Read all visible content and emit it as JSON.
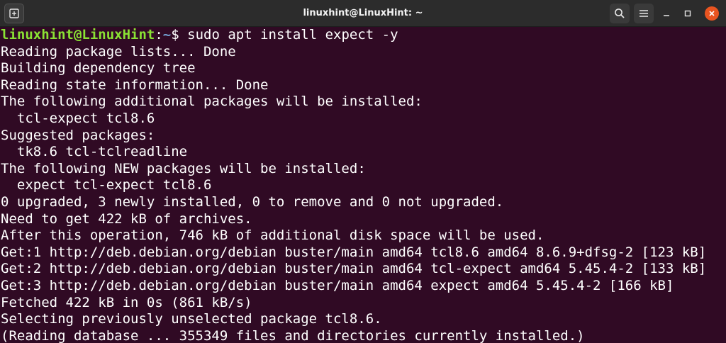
{
  "window": {
    "title": "linuxhint@LinuxHint: ~"
  },
  "icons": {
    "new_tab": "new-tab-icon",
    "search": "search-icon",
    "menu": "hamburger-menu-icon",
    "minimize": "minimize-icon",
    "maximize": "maximize-icon",
    "close": "close-icon"
  },
  "colors": {
    "terminal_background": "#300a24",
    "prompt_user": "#8ae234",
    "prompt_path": "#729fcf",
    "close_button": "#e95420"
  },
  "prompt": {
    "user_host": "linuxhint@LinuxHint",
    "separator": ":",
    "path": "~",
    "symbol": "$ ",
    "command": "sudo apt install expect -y"
  },
  "output": [
    "Reading package lists... Done",
    "Building dependency tree",
    "Reading state information... Done",
    "The following additional packages will be installed:",
    "  tcl-expect tcl8.6",
    "Suggested packages:",
    "  tk8.6 tcl-tclreadline",
    "The following NEW packages will be installed:",
    "  expect tcl-expect tcl8.6",
    "0 upgraded, 3 newly installed, 0 to remove and 0 not upgraded.",
    "Need to get 422 kB of archives.",
    "After this operation, 746 kB of additional disk space will be used.",
    "Get:1 http://deb.debian.org/debian buster/main amd64 tcl8.6 amd64 8.6.9+dfsg-2 [123 kB]",
    "Get:2 http://deb.debian.org/debian buster/main amd64 tcl-expect amd64 5.45.4-2 [133 kB]",
    "Get:3 http://deb.debian.org/debian buster/main amd64 expect amd64 5.45.4-2 [166 kB]",
    "Fetched 422 kB in 0s (861 kB/s)",
    "Selecting previously unselected package tcl8.6.",
    "(Reading database ... 355349 files and directories currently installed.)"
  ]
}
